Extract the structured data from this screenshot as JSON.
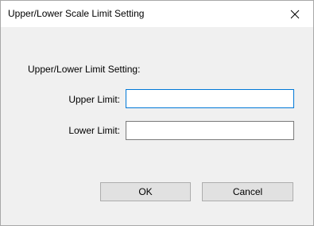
{
  "window": {
    "title": "Upper/Lower Scale Limit Setting",
    "close_icon": "close-icon"
  },
  "form": {
    "section_label": "Upper/Lower Limit Setting:",
    "upper_limit": {
      "label": "Upper Limit:",
      "value": ""
    },
    "lower_limit": {
      "label": "Lower Limit:",
      "value": ""
    }
  },
  "buttons": {
    "ok_label": "OK",
    "cancel_label": "Cancel"
  },
  "colors": {
    "dialog_background": "#f0f0f0",
    "titlebar_background": "#ffffff",
    "focus_border": "#0078d7",
    "button_face": "#e1e1e1"
  }
}
